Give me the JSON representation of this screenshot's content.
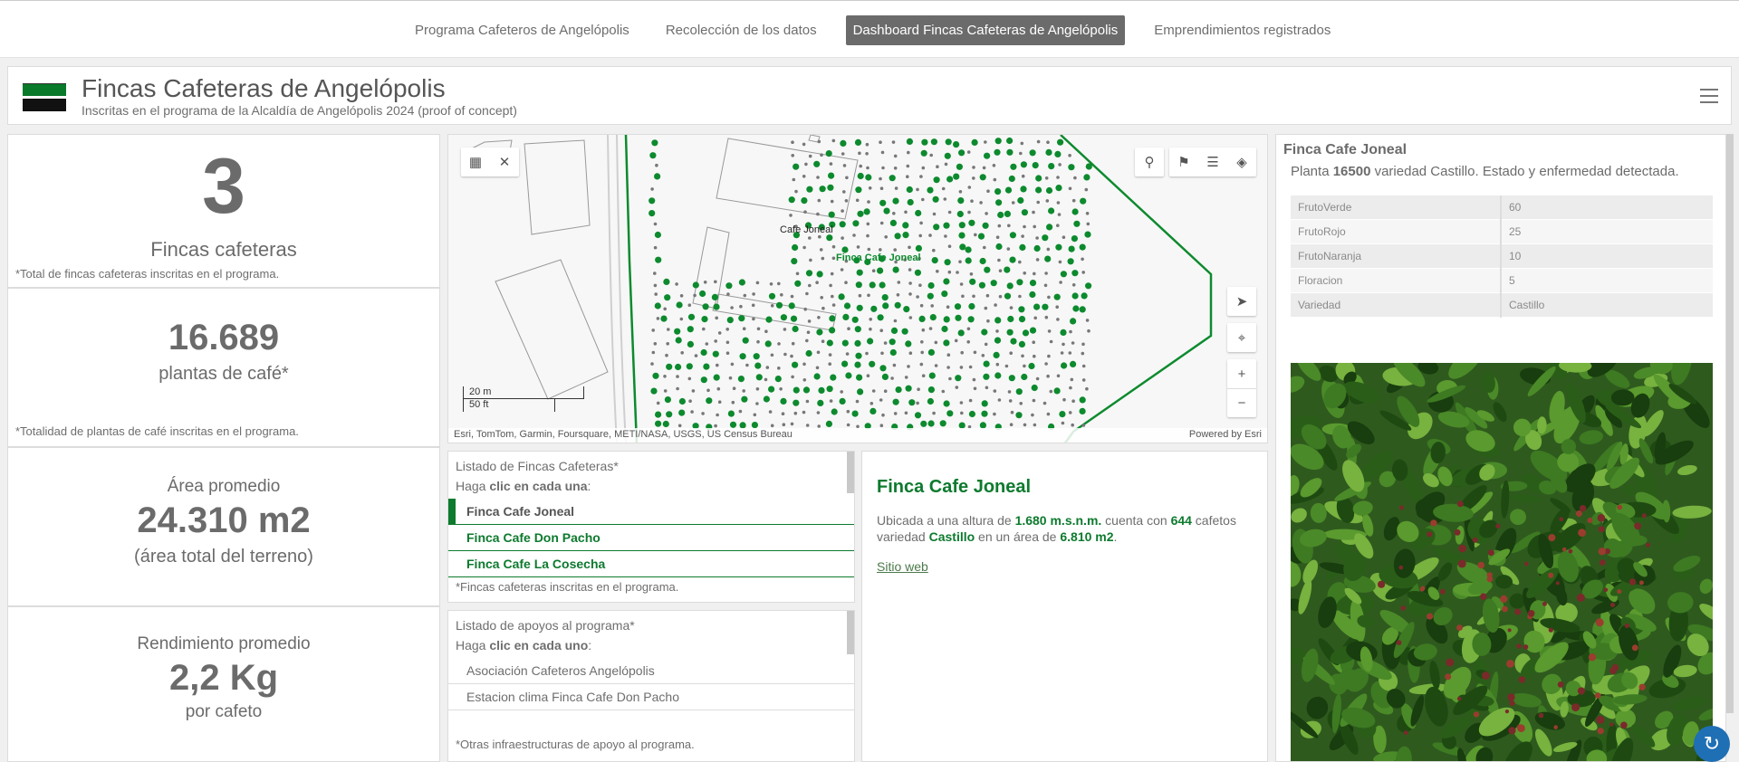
{
  "nav": {
    "tabs": [
      "Programa Cafeteros de Angelópolis",
      "Recolección de los datos",
      "Dashboard Fincas Cafeteras de Angelópolis",
      "Emprendimientos registrados"
    ],
    "active_index": 2
  },
  "header": {
    "title": "Fincas Cafeteras de Angelópolis",
    "subtitle": "Inscritas en el programa de la Alcaldía de Angelópolis 2024 (proof of concept)",
    "flag_colors": [
      "#087a2a",
      "#ffffff",
      "#111111"
    ]
  },
  "stats": {
    "fincas": {
      "value": "3",
      "label": "Fincas cafeteras",
      "note": "*Total de fincas cafeteras inscritas en el programa."
    },
    "plantas": {
      "value": "16.689",
      "label": "plantas de café*",
      "note": "*Totalidad de plantas de café inscritas en el programa."
    },
    "area": {
      "title": "Área promedio",
      "value": "24.310 m2",
      "label": "(área total del terreno)"
    },
    "rendimiento": {
      "title": "Rendimiento promedio",
      "value": "2,2 Kg",
      "label": "por cafeto"
    }
  },
  "map": {
    "labels": {
      "place": "Cafe Joneal",
      "selected": "Finca Cafe Joneal"
    },
    "scale": {
      "metric": "20 m",
      "imperial": "50 ft"
    },
    "attribution": "Esri, TomTom, Garmin, Foursquare, METI/NASA, USGS, US Census Bureau",
    "powered": "Powered by Esri",
    "icons": [
      "select-icon",
      "close-icon",
      "search-icon",
      "bookmark-icon",
      "layer-list-icon",
      "layers-icon",
      "compass-icon",
      "locate-icon",
      "zoom-in-icon",
      "zoom-out-icon"
    ],
    "accent": "#0d8a2e"
  },
  "fincas_list": {
    "header": "Listado de Fincas Cafeteras*",
    "instruction_pre": "Haga ",
    "instruction_bold": "clic en cada una",
    "instruction_post": ":",
    "items": [
      "Finca Cafe Joneal",
      "Finca Cafe Don Pacho",
      "Finca Cafe La Cosecha"
    ],
    "footnote": "*Fincas cafeteras inscritas en el programa."
  },
  "apoyos_list": {
    "header": "Listado de apoyos al programa*",
    "instruction_pre": "Haga ",
    "instruction_bold": "clic en cada uno",
    "instruction_post": ":",
    "items": [
      "Asociación Cafeteros Angelópolis",
      "Estacion clima Finca Cafe Don Pacho"
    ],
    "footnote": "*Otras infraestructuras de apoyo al programa."
  },
  "detail": {
    "title": "Finca Cafe Joneal",
    "t1": "Ubicada a una altura de ",
    "altura": "1.680 m.s.n.m.",
    "t2": " cuenta con ",
    "cafetos": "644",
    "t3": " cafetos variedad ",
    "variedad": "Castillo",
    "t4": " en un área de ",
    "area": "6.810 m2",
    "t5": ".",
    "link": "Sitio web"
  },
  "popup": {
    "title": "Finca Cafe Joneal",
    "d1": "Planta ",
    "planta": "16500",
    "d2": " variedad Castillo. Estado y enfermedad detectada.",
    "rows": [
      [
        "FrutoVerde",
        "60"
      ],
      [
        "FrutoRojo",
        "25"
      ],
      [
        "FrutoNaranja",
        "10"
      ],
      [
        "Floracion",
        "5"
      ],
      [
        "Variedad",
        "Castillo"
      ]
    ]
  }
}
